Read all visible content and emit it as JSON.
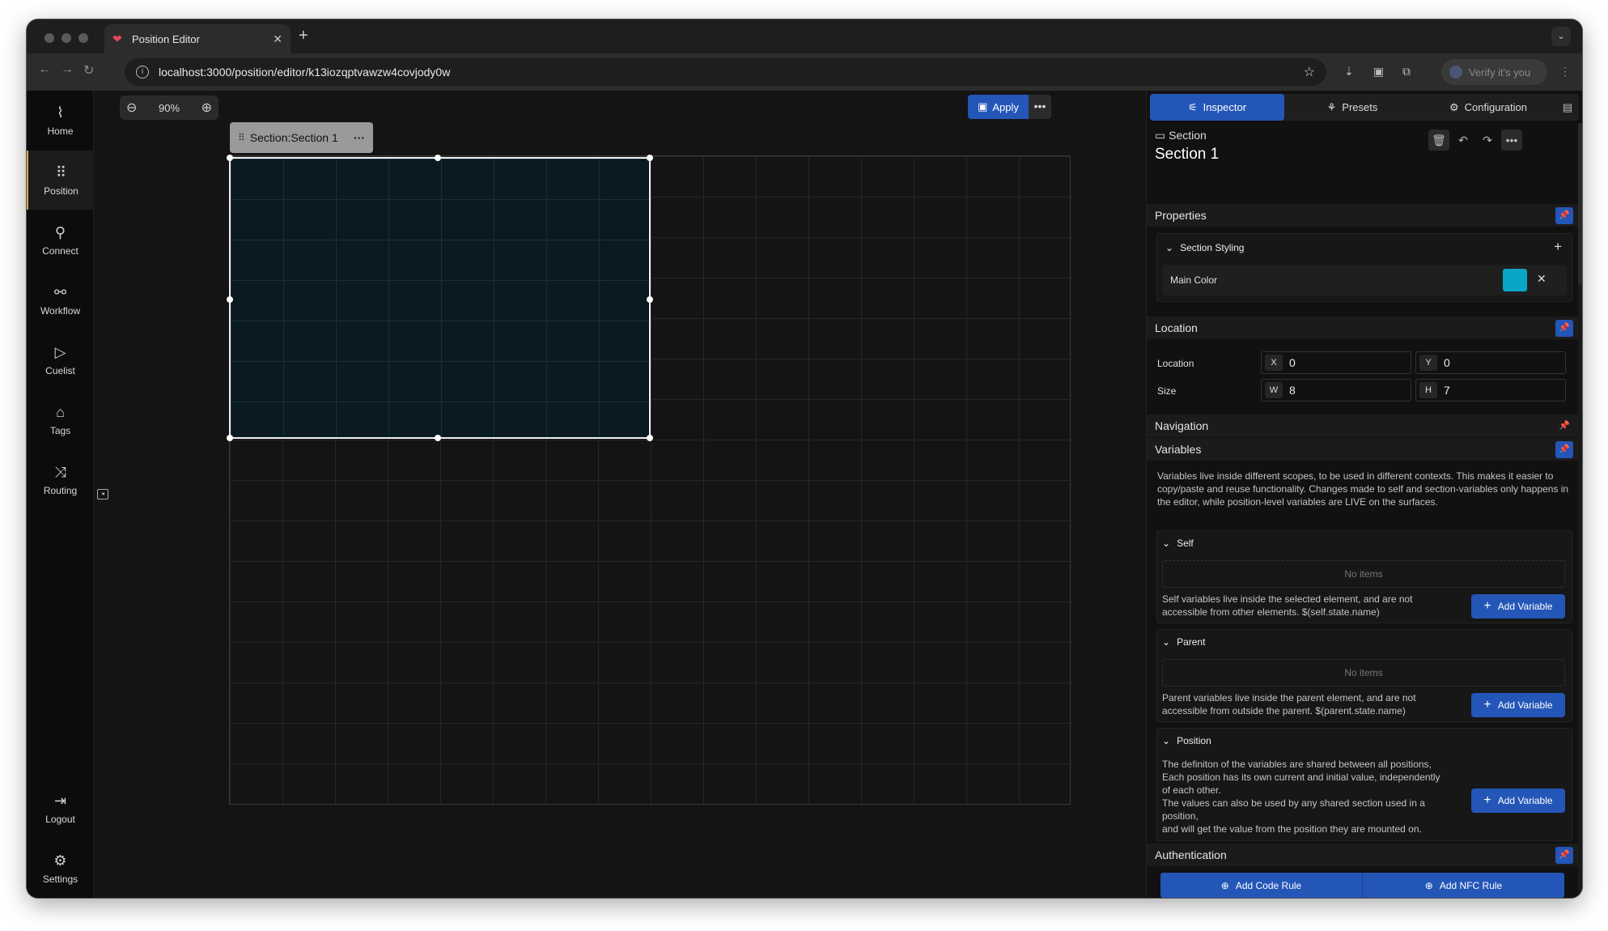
{
  "browser": {
    "tab_title": "Position Editor",
    "url": "localhost:3000/position/editor/k13iozqptvawzw4covjody0w",
    "verify_label": "Verify it's you"
  },
  "sidebar": {
    "items": [
      {
        "label": "Home",
        "icon": "activity-icon"
      },
      {
        "label": "Position",
        "icon": "grid-dots-icon"
      },
      {
        "label": "Connect",
        "icon": "plug-icon"
      },
      {
        "label": "Workflow",
        "icon": "workflow-icon"
      },
      {
        "label": "Cuelist",
        "icon": "play-icon"
      },
      {
        "label": "Tags",
        "icon": "tag-icon"
      },
      {
        "label": "Routing",
        "icon": "shuffle-icon"
      }
    ],
    "bottom": [
      {
        "label": "Logout",
        "icon": "logout-icon"
      },
      {
        "label": "Settings",
        "icon": "gear-icon"
      }
    ],
    "active": "Position",
    "accent_color": "#d8a64a"
  },
  "canvas": {
    "zoom": "90%",
    "apply_label": "Apply",
    "section_tag": "Section:Section 1"
  },
  "panel": {
    "tabs": [
      "Inspector",
      "Presets",
      "Configuration"
    ],
    "active_tab": "Inspector",
    "element_kind": "Section",
    "element_name": "Section 1",
    "properties": {
      "title": "Properties",
      "group_title": "Section Styling",
      "main_color_label": "Main Color",
      "main_color": "#0ba5c7"
    },
    "location": {
      "title": "Location",
      "location_label": "Location",
      "size_label": "Size",
      "x_key": "X",
      "x": "0",
      "y_key": "Y",
      "y": "0",
      "w_key": "W",
      "w": "8",
      "h_key": "H",
      "h": "7"
    },
    "navigation": {
      "title": "Navigation"
    },
    "variables": {
      "title": "Variables",
      "description": "Variables live inside different scopes, to be used in different contexts. This makes it easier to copy/paste and reuse functionality. Changes made to self and section-variables only happens in the editor, while position-level variables are LIVE on the surfaces.",
      "self": {
        "title": "Self",
        "empty": "No items",
        "note": "Self variables live inside the selected element, and are not accessible from other elements. $(self.state.name)",
        "button": "Add Variable"
      },
      "parent": {
        "title": "Parent",
        "empty": "No items",
        "note": "Parent variables live inside the parent element, and are not accessible from outside the parent. $(parent.state.name)",
        "button": "Add Variable"
      },
      "position": {
        "title": "Position",
        "note_lines": [
          "The definiton of the variables are shared between all positions,",
          "Each position has its own current and initial value, independently",
          "of each other.",
          "The values can also be used by any shared section used in a",
          "position,",
          "and will get the value from the position they are mounted on."
        ],
        "button": "Add Variable"
      }
    },
    "authentication": {
      "title": "Authentication",
      "add_code_rule": "Add Code Rule",
      "add_nfc_rule": "Add NFC Rule"
    },
    "accent_color": "#2456b8"
  }
}
